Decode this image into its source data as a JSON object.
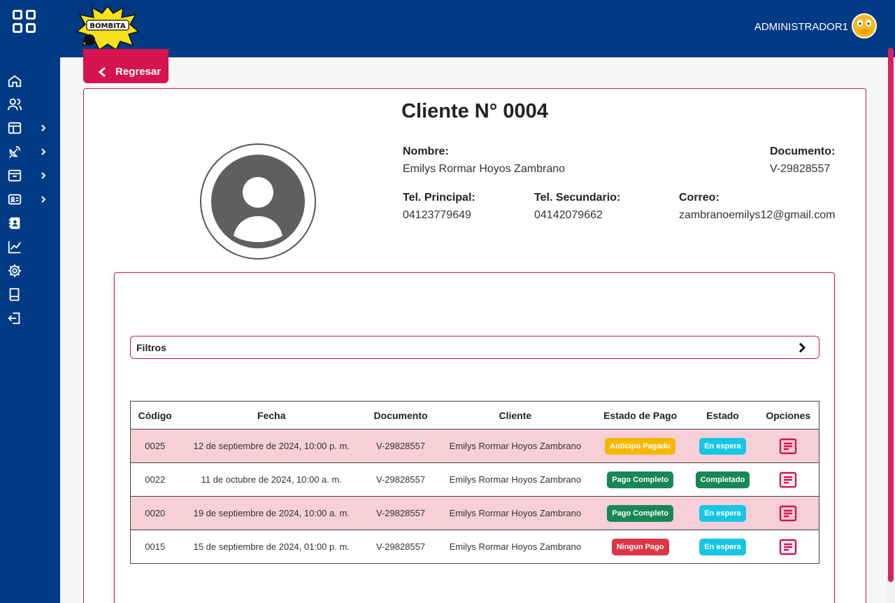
{
  "header": {
    "logo_alt": "BOMBITA RECREACION",
    "user_name": "ADMINISTRADOR1"
  },
  "sidebar": {
    "items": [
      {
        "icon": "home-icon",
        "has_submenu": false
      },
      {
        "icon": "users-icon",
        "has_submenu": false
      },
      {
        "icon": "layout-icon",
        "has_submenu": true
      },
      {
        "icon": "satellite-icon",
        "has_submenu": true
      },
      {
        "icon": "archive-icon",
        "has_submenu": true
      },
      {
        "icon": "id-card-icon",
        "has_submenu": true
      },
      {
        "icon": "contact-book-icon",
        "has_submenu": false
      },
      {
        "icon": "chart-line-icon",
        "has_submenu": false
      },
      {
        "icon": "gear-icon",
        "has_submenu": false
      },
      {
        "icon": "book-icon",
        "has_submenu": false
      },
      {
        "icon": "logout-icon",
        "has_submenu": false
      }
    ]
  },
  "back_button": {
    "label": "Regresar"
  },
  "client": {
    "title": "Cliente N° 0004",
    "nombre_label": "Nombre:",
    "nombre": "Emilys Rormar Hoyos Zambrano",
    "documento_label": "Documento:",
    "documento": "V-29828557",
    "tel_principal_label": "Tel. Principal:",
    "tel_principal": "04123779649",
    "tel_secundario_label": "Tel. Secundario:",
    "tel_secundario": "04142079662",
    "correo_label": "Correo:",
    "correo": "zambranoemilys12@gmail.com"
  },
  "filters": {
    "label": "Filtros"
  },
  "table": {
    "headers": [
      "Código",
      "Fecha",
      "Documento",
      "Cliente",
      "Estado de Pago",
      "Estado",
      "Opciones"
    ],
    "rows": [
      {
        "codigo": "0025",
        "fecha": "12 de septiembre de 2024, 10:00 p. m.",
        "documento": "V-29828557",
        "cliente": "Emilys Rormar Hoyos Zambrano",
        "pago": "Anticipo Pagado",
        "pago_color": "#f5b800",
        "estado": "En espera",
        "estado_color": "#17c6e6"
      },
      {
        "codigo": "0022",
        "fecha": "11 de octubre de 2024, 10:00 a. m.",
        "documento": "V-29828557",
        "cliente": "Emilys Rormar Hoyos Zambrano",
        "pago": "Pago Completo",
        "pago_color": "#198754",
        "estado": "Completado",
        "estado_color": "#198754"
      },
      {
        "codigo": "0020",
        "fecha": "19 de septiembre de 2024, 10:00 a. m.",
        "documento": "V-29828557",
        "cliente": "Emilys Rormar Hoyos Zambrano",
        "pago": "Pago Completo",
        "pago_color": "#198754",
        "estado": "En espera",
        "estado_color": "#17c6e6"
      },
      {
        "codigo": "0015",
        "fecha": "15 de septiembre de 2024, 01:00 p. m.",
        "documento": "V-29828557",
        "cliente": "Emilys Rormar Hoyos Zambrano",
        "pago": "Ningun Pago",
        "pago_color": "#dc3545",
        "estado": "En espera",
        "estado_color": "#17c6e6"
      }
    ]
  },
  "colors": {
    "primary_blue": "#003a85",
    "accent_pink": "#d4134f",
    "row_pink": "#f6cfd8"
  }
}
